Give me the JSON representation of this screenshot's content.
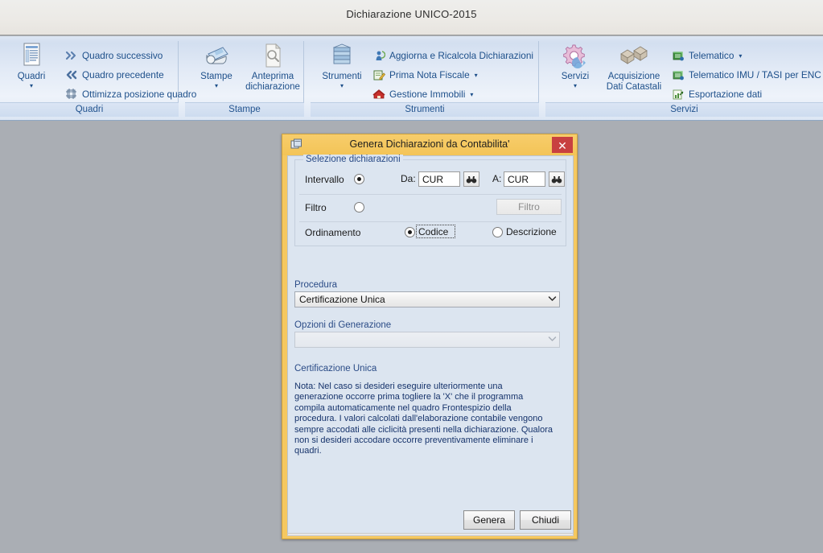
{
  "app": {
    "title": "Dichiarazione UNICO-2015"
  },
  "ribbon": {
    "groups": [
      {
        "name": "Quadri",
        "label": "Quadri",
        "big_button": {
          "label": "Quadri",
          "icon": "quadri-list-icon",
          "caret": "▾"
        },
        "items": [
          {
            "label": "Quadro successivo",
            "icon": "double-chevron-right-icon",
            "caret": ""
          },
          {
            "label": "Quadro precedente",
            "icon": "double-chevron-left-icon",
            "caret": ""
          },
          {
            "label": "Ottimizza posizione quadro",
            "icon": "optimize-layout-icon",
            "caret": ""
          }
        ]
      },
      {
        "name": "Stampe",
        "label": "Stampe",
        "big_button": {
          "label": "Stampe",
          "icon": "printer-icon",
          "caret": "▾"
        },
        "big_button2": {
          "label_line1": "Anteprima",
          "label_line2": "dichiarazione",
          "icon": "page-preview-icon"
        },
        "items": []
      },
      {
        "name": "Strumenti",
        "label": "Strumenti",
        "big_button": {
          "label": "Strumenti",
          "icon": "database-stack-icon",
          "caret": "▾"
        },
        "items": [
          {
            "label": "Aggiorna e Ricalcola Dichiarazioni",
            "icon": "refresh-person-icon",
            "caret": ""
          },
          {
            "label": "Prima Nota Fiscale",
            "icon": "notepad-pencil-icon",
            "caret": "▾"
          },
          {
            "label": "Gestione Immobili",
            "icon": "house-red-icon",
            "caret": "▾"
          }
        ]
      },
      {
        "name": "Servizi",
        "label": "Servizi",
        "big_button": {
          "label": "Servizi",
          "icon": "gears-icon",
          "caret": "▾"
        },
        "big_button2": {
          "label_line1": "Acquisizione",
          "label_line2": "Dati Catastali",
          "icon": "boxes-icon"
        },
        "items": [
          {
            "label": "Telematico",
            "icon": "telematic-green-icon",
            "caret": "▾"
          },
          {
            "label": "Telematico IMU / TASI per ENC",
            "icon": "telematic-green-icon",
            "caret": "▾"
          },
          {
            "label": "Esportazione dati",
            "icon": "export-chart-icon",
            "caret": ""
          }
        ]
      }
    ]
  },
  "dialog": {
    "title": "Genera Dichiarazioni da Contabilita'",
    "title_icon": "window-copy-icon",
    "close_label": "✕",
    "group_selezione": {
      "title": "Selezione dichiarazioni",
      "intervallo_label": "Intervallo",
      "intervallo_checked": true,
      "da_label": "Da:",
      "da_value": "CUR",
      "da_lookup_icon": "binoculars-icon",
      "a_label": "A:",
      "a_value": "CUR",
      "a_lookup_icon": "binoculars-icon",
      "filtro_label": "Filtro",
      "filtro_checked": false,
      "filtro_button_label": "Filtro",
      "ordinamento_label": "Ordinamento",
      "ordinamento_options": [
        {
          "label": "Codice",
          "checked": true
        },
        {
          "label": "Descrizione",
          "checked": false
        }
      ]
    },
    "procedura": {
      "label": "Procedura",
      "value": "Certificazione Unica",
      "arrow": "⌄"
    },
    "opzioni": {
      "label": "Opzioni di Generazione",
      "value": "",
      "arrow": "⌄",
      "disabled": true
    },
    "note": {
      "heading": "Certificazione Unica",
      "text": "Nota: Nel caso si desideri eseguire ulteriormente una generazione occorre prima togliere la 'X' che il programma compila automaticamente nel quadro Frontespizio della procedura. I valori calcolati dall'elaborazione contabile vengono sempre accodati alle ciclicità presenti nella dichiarazione. Qualora non si desideri accodare occorre preventivamente eliminare i quadri."
    },
    "buttons": {
      "genera": "Genera",
      "chiudi": "Chiudi"
    }
  },
  "colors": {
    "dialog_frame": "#f5c860",
    "dialog_body": "#dce5f0",
    "close_red": "#c84040",
    "ribbon_accent": "#1d4f8a",
    "workarea": "#aaaeb4"
  }
}
